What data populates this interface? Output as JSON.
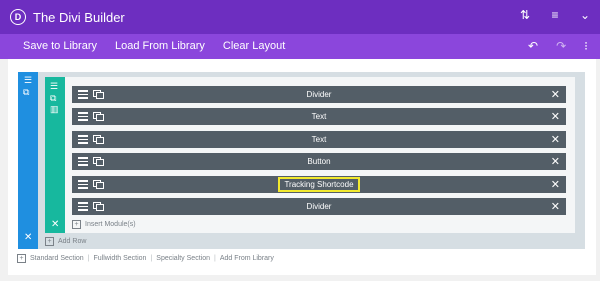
{
  "topbar": {
    "logo_letter": "D",
    "title": "The Divi Builder",
    "icons": [
      "sort-icon",
      "menu-icon",
      "chevron-down-icon"
    ]
  },
  "actionbar": {
    "save_label": "Save to Library",
    "load_label": "From Library",
    "load_prefix": "Load",
    "clear_label": "Clear Layout",
    "icons": [
      "undo-icon",
      "redo-icon",
      "history-icon"
    ]
  },
  "section": {
    "icons": [
      "section-settings-icon",
      "section-duplicate-icon",
      "section-close-icon"
    ]
  },
  "row": {
    "icons": [
      "row-handle-icon",
      "row-duplicate-icon",
      "row-columns-icon",
      "row-close-icon"
    ]
  },
  "modules": [
    {
      "label": "Divider"
    },
    {
      "label": "Text"
    },
    {
      "label": "Text"
    },
    {
      "label": "Button"
    },
    {
      "label": "Tracking Shortcode",
      "highlighted": true
    },
    {
      "label": "Divider"
    }
  ],
  "insert_module_label": "Insert Module(s)",
  "add_row_label": "Add Row",
  "bottom_links": [
    "Standard Section",
    "Fullwidth Section",
    "Specialty Section",
    "Add From Library"
  ],
  "colors": {
    "topbar": "#6d2ec0",
    "actionbar": "#8b46dc",
    "section": "#1f8fe0",
    "row": "#17b89e",
    "module": "#535e67",
    "highlight": "#f2e92e"
  }
}
